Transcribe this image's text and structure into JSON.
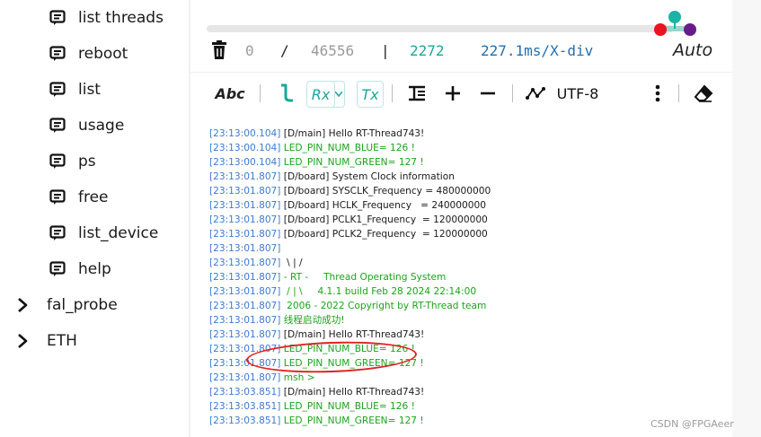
{
  "sidebar": {
    "commands": [
      {
        "label": "list threads",
        "icon": "terminal-command-icon"
      },
      {
        "label": "reboot",
        "icon": "terminal-command-icon"
      },
      {
        "label": "list",
        "icon": "terminal-command-icon"
      },
      {
        "label": "usage",
        "icon": "terminal-command-icon"
      },
      {
        "label": "ps",
        "icon": "terminal-command-icon"
      },
      {
        "label": "free",
        "icon": "terminal-command-icon"
      },
      {
        "label": "list_device",
        "icon": "terminal-command-icon"
      },
      {
        "label": "help",
        "icon": "terminal-command-icon"
      }
    ],
    "groups": [
      {
        "label": "fal_probe",
        "icon": "chevron-right-icon"
      },
      {
        "label": "ETH",
        "icon": "chevron-right-icon"
      }
    ]
  },
  "status": {
    "count_a": "0",
    "sep1": "/",
    "count_total": "46556",
    "sep2": "|",
    "count_b": "2272",
    "time_div": "227.1ms/X-div",
    "auto": "Auto"
  },
  "toolbar": {
    "text_format": "Abc",
    "rx": "Rx",
    "tx": "Tx",
    "encoding": "UTF-8"
  },
  "log": [
    {
      "ts": "[23:13:00.104]",
      "msg": " [D/main] Hello RT-Thread743!",
      "color": "black"
    },
    {
      "ts": "[23:13:00.104]",
      "msg": " LED_PIN_NUM_BLUE= 126 !",
      "color": "green"
    },
    {
      "ts": "[23:13:00.104]",
      "msg": " LED_PIN_NUM_GREEN= 127 !",
      "color": "green"
    },
    {
      "ts": "[23:13:01.807]",
      "msg": " [D/board] System Clock information",
      "color": "black"
    },
    {
      "ts": "[23:13:01.807]",
      "msg": " [D/board] SYSCLK_Frequency = 480000000",
      "color": "black"
    },
    {
      "ts": "[23:13:01.807]",
      "msg": " [D/board] HCLK_Frequency   = 240000000",
      "color": "black"
    },
    {
      "ts": "[23:13:01.807]",
      "msg": " [D/board] PCLK1_Frequency  = 120000000",
      "color": "black"
    },
    {
      "ts": "[23:13:01.807]",
      "msg": " [D/board] PCLK2_Frequency  = 120000000",
      "color": "black"
    },
    {
      "ts": "[23:13:01.807]",
      "msg": "",
      "color": "black"
    },
    {
      "ts": "[23:13:01.807]",
      "msg": "  \\ | /",
      "color": "black"
    },
    {
      "ts": "[23:13:01.807]",
      "msg": " - RT -     Thread Operating System",
      "color": "green"
    },
    {
      "ts": "[23:13:01.807]",
      "msg": "  / | \\     4.1.1 build Feb 28 2024 22:14:00",
      "color": "green"
    },
    {
      "ts": "[23:13:01.807]",
      "msg": "  2006 - 2022 Copyright by RT-Thread team",
      "color": "green"
    },
    {
      "ts": "[23:13:01.807]",
      "msg": " 线程启动成功!",
      "color": "green"
    },
    {
      "ts": "[23:13:01.807]",
      "msg": " [D/main] Hello RT-Thread743!",
      "color": "black"
    },
    {
      "ts": "[23:13:01.807]",
      "msg": " LED_PIN_NUM_BLUE= 126 !",
      "color": "green"
    },
    {
      "ts": "[23:13:01.807]",
      "msg": " LED_PIN_NUM_GREEN= 127 !",
      "color": "green"
    },
    {
      "ts": "[23:13:01.807]",
      "msg": " msh >",
      "color": "green"
    },
    {
      "ts": "[23:13:03.851]",
      "msg": " [D/main] Hello RT-Thread743!",
      "color": "black"
    },
    {
      "ts": "[23:13:03.851]",
      "msg": " LED_PIN_NUM_BLUE= 126 !",
      "color": "green"
    },
    {
      "ts": "[23:13:03.851]",
      "msg": " LED_PIN_NUM_GREEN= 127 !",
      "color": "green"
    }
  ],
  "watermark": "CSDN @FPGAeer",
  "colors": {
    "accent": "#17a89a",
    "timestamp": "#3a7bd5",
    "log_green": "#1aa31a",
    "annotation": "#e02020",
    "dot_red": "#e8141f",
    "dot_teal": "#1bb3a3",
    "dot_purple": "#6a1b8a"
  }
}
